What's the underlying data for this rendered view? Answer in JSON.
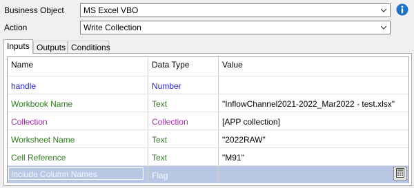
{
  "form": {
    "business_object_label": "Business Object",
    "business_object_value": "MS Excel VBO",
    "action_label": "Action",
    "action_value": "Write Collection",
    "info_icon": "info-icon"
  },
  "tabs": [
    {
      "label": "Inputs",
      "active": true
    },
    {
      "label": "Outputs",
      "active": false
    },
    {
      "label": "Conditions",
      "active": false
    }
  ],
  "grid": {
    "headers": {
      "name": "Name",
      "type": "Data Type",
      "value": "Value"
    },
    "rows": [
      {
        "name": "handle",
        "type": "Number",
        "value": ""
      },
      {
        "name": "Workbook Name",
        "type": "Text",
        "value": "\"InflowChannel2021-2022_Mar2022 - test.xlsx\""
      },
      {
        "name": "Collection",
        "type": "Collection",
        "value": "[APP collection]"
      },
      {
        "name": "Worksheet Name",
        "type": "Text",
        "value": "\"2022RAW\""
      },
      {
        "name": "Cell Reference",
        "type": "Text",
        "value": "\"M91\""
      },
      {
        "name": "Include Column Names",
        "type": "Flag",
        "value": ""
      }
    ]
  },
  "colors": {
    "number_type": "#1f1fcf",
    "text_type": "#2e7d1e",
    "collection_type": "#a826a8",
    "selected_row": "#b8c8e4"
  }
}
